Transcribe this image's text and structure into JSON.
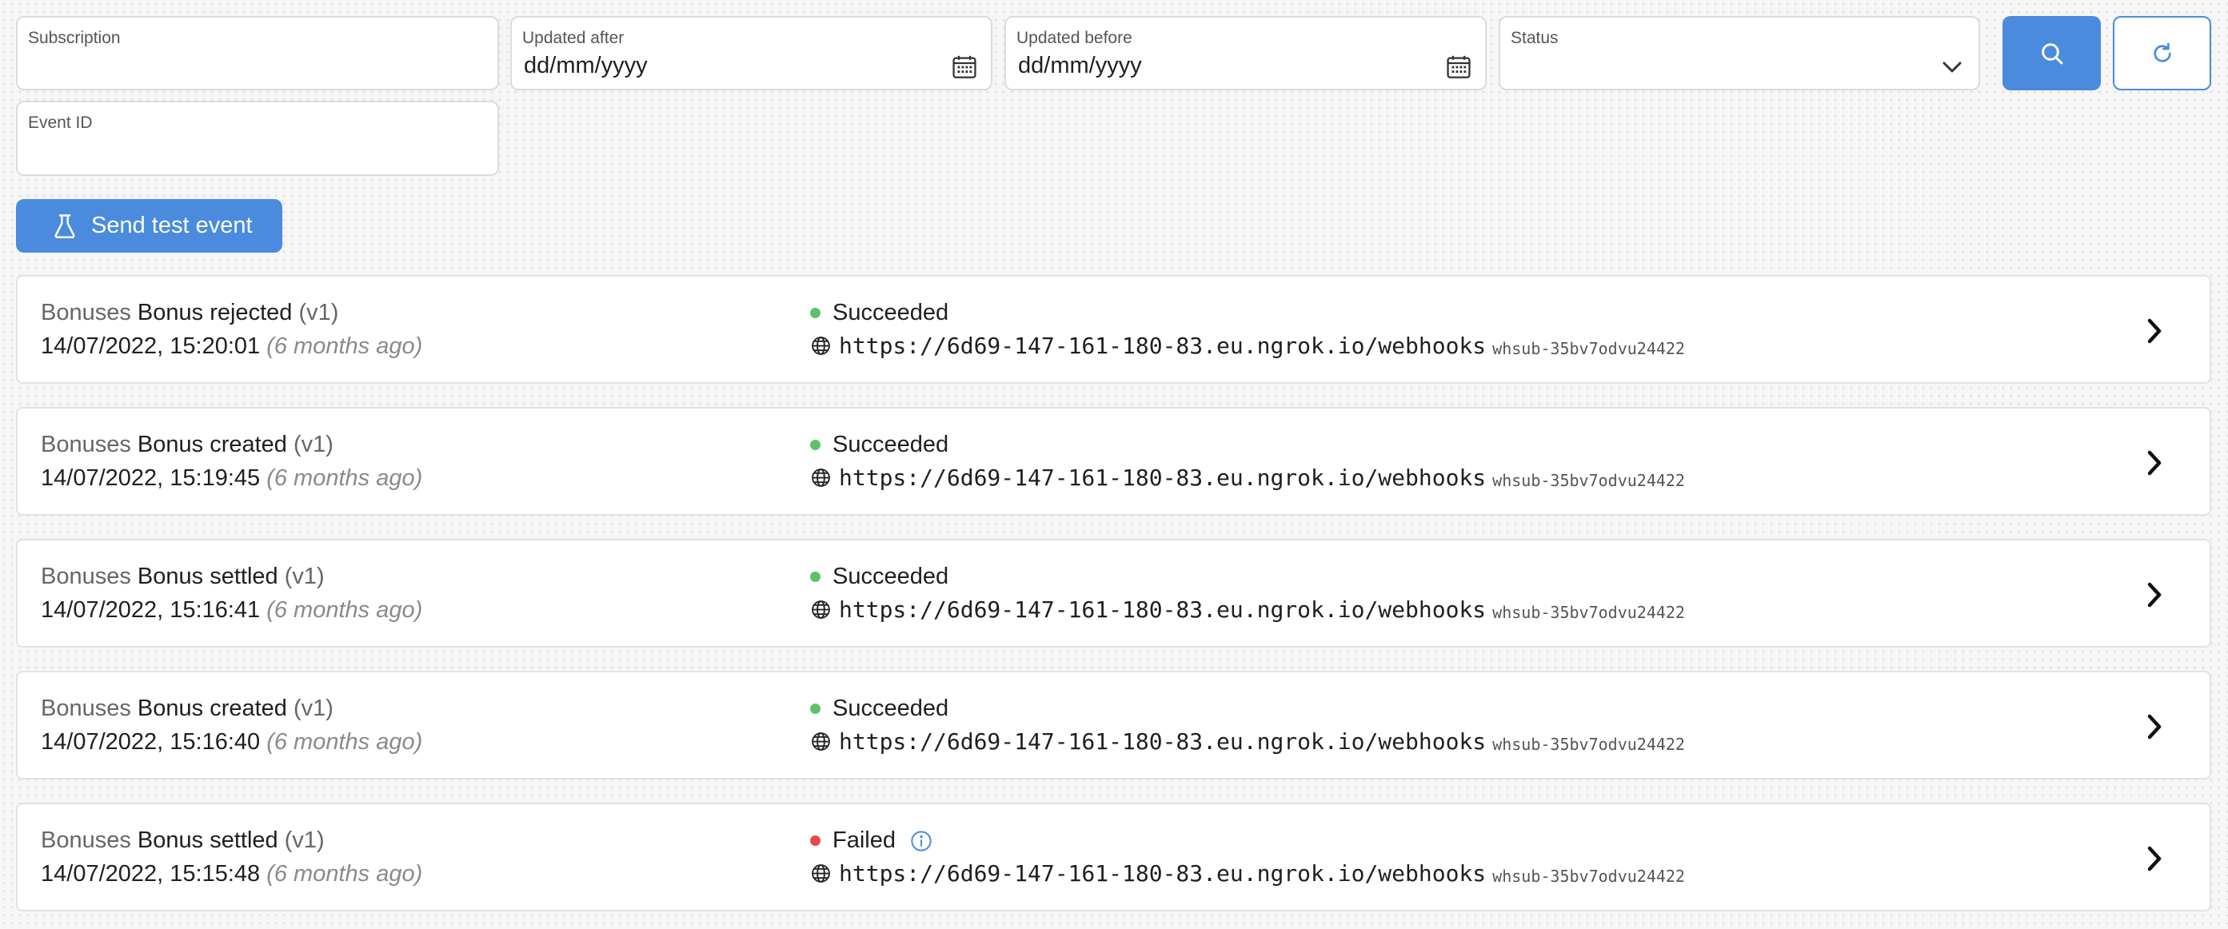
{
  "filters": {
    "subscription": {
      "label": "Subscription",
      "value": ""
    },
    "updated_after": {
      "label": "Updated after",
      "value": "dd/mm/yyyy"
    },
    "updated_before": {
      "label": "Updated before",
      "value": "dd/mm/yyyy"
    },
    "status": {
      "label": "Status",
      "value": ""
    },
    "event_id": {
      "label": "Event ID",
      "value": ""
    }
  },
  "buttons": {
    "search_icon": "search-icon",
    "refresh_icon": "refresh-icon",
    "send_test_event": "Send test event",
    "send_test_icon": "flask-icon"
  },
  "colors": {
    "accent": "#4a8bde",
    "success": "#5cc26a",
    "failed": "#e84848"
  },
  "events": [
    {
      "category": "Bonuses",
      "name": "Bonus rejected",
      "version": "(v1)",
      "timestamp": "14/07/2022, 15:20:01",
      "relative": "(6 months ago)",
      "status": "Succeeded",
      "url": "https://6d69-147-161-180-83.eu.ngrok.io/webhooks",
      "subscription_id": "whsub-35bv7odvu24422"
    },
    {
      "category": "Bonuses",
      "name": "Bonus created",
      "version": "(v1)",
      "timestamp": "14/07/2022, 15:19:45",
      "relative": "(6 months ago)",
      "status": "Succeeded",
      "url": "https://6d69-147-161-180-83.eu.ngrok.io/webhooks",
      "subscription_id": "whsub-35bv7odvu24422"
    },
    {
      "category": "Bonuses",
      "name": "Bonus settled",
      "version": "(v1)",
      "timestamp": "14/07/2022, 15:16:41",
      "relative": "(6 months ago)",
      "status": "Succeeded",
      "url": "https://6d69-147-161-180-83.eu.ngrok.io/webhooks",
      "subscription_id": "whsub-35bv7odvu24422"
    },
    {
      "category": "Bonuses",
      "name": "Bonus created",
      "version": "(v1)",
      "timestamp": "14/07/2022, 15:16:40",
      "relative": "(6 months ago)",
      "status": "Succeeded",
      "url": "https://6d69-147-161-180-83.eu.ngrok.io/webhooks",
      "subscription_id": "whsub-35bv7odvu24422"
    },
    {
      "category": "Bonuses",
      "name": "Bonus settled",
      "version": "(v1)",
      "timestamp": "14/07/2022, 15:15:48",
      "relative": "(6 months ago)",
      "status": "Failed",
      "url": "https://6d69-147-161-180-83.eu.ngrok.io/webhooks",
      "subscription_id": "whsub-35bv7odvu24422"
    }
  ]
}
